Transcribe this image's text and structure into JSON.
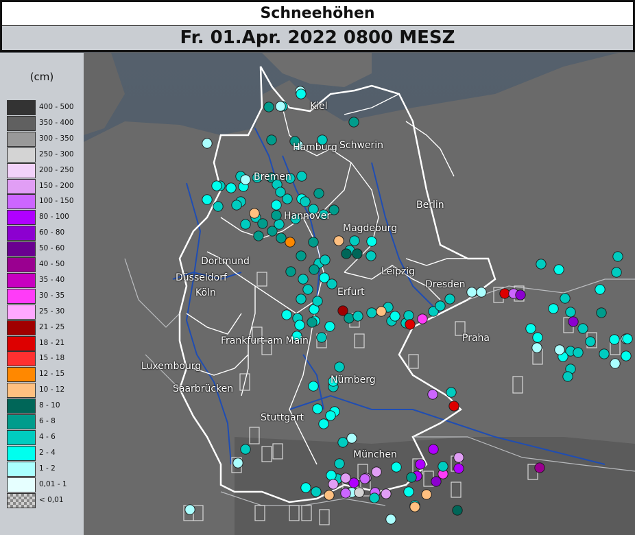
{
  "header": {
    "title": "Schneehöhen",
    "subtitle": "Fr. 01.Apr. 2022 0800 MESZ"
  },
  "legend": {
    "unit": "(cm)",
    "classes": [
      {
        "label": "400 - 500",
        "color": "#333333"
      },
      {
        "label": "350 - 400",
        "color": "#606060"
      },
      {
        "label": "300 - 350",
        "color": "#999999"
      },
      {
        "label": "250 - 300",
        "color": "#d4d4d4"
      },
      {
        "label": "200 - 250",
        "color": "#f2d2fa"
      },
      {
        "label": "150 - 200",
        "color": "#e19ef5"
      },
      {
        "label": "100 - 150",
        "color": "#cc66ff"
      },
      {
        "label": "80 - 100",
        "color": "#b000ff"
      },
      {
        "label": "60 - 80",
        "color": "#8c00d0"
      },
      {
        "label": "50 - 60",
        "color": "#6a0090"
      },
      {
        "label": "40 - 50",
        "color": "#9a0090"
      },
      {
        "label": "35 - 40",
        "color": "#c800c0"
      },
      {
        "label": "30 - 35",
        "color": "#ff3cf8"
      },
      {
        "label": "25 - 30",
        "color": "#ffa8ff"
      },
      {
        "label": "21 - 25",
        "color": "#a00000"
      },
      {
        "label": "18 - 21",
        "color": "#dd0000"
      },
      {
        "label": "15 - 18",
        "color": "#ff3030"
      },
      {
        "label": "12 - 15",
        "color": "#ff8800"
      },
      {
        "label": "10 - 12",
        "color": "#ffc080"
      },
      {
        "label": "8 - 10",
        "color": "#006658"
      },
      {
        "label": "6 - 8",
        "color": "#009c8c"
      },
      {
        "label": "4 - 6",
        "color": "#00ccc0"
      },
      {
        "label": "2 - 4",
        "color": "#00ffee"
      },
      {
        "label": "1 - 2",
        "color": "#aaffff"
      },
      {
        "label": "0,01 - 1",
        "color": "#e6ffff"
      },
      {
        "label": "< 0,01",
        "color": "checker"
      }
    ]
  },
  "cities": [
    {
      "name": "Kiel"
    },
    {
      "name": "Hamburg"
    },
    {
      "name": "Schwerin"
    },
    {
      "name": "Bremen"
    },
    {
      "name": "Berlin"
    },
    {
      "name": "Hannover"
    },
    {
      "name": "Magdeburg"
    },
    {
      "name": "Dortmund"
    },
    {
      "name": "Düsseldorf"
    },
    {
      "name": "Leipzig"
    },
    {
      "name": "Köln"
    },
    {
      "name": "Dresden"
    },
    {
      "name": "Erfurt"
    },
    {
      "name": "Frankfurt am Main"
    },
    {
      "name": "Praha"
    },
    {
      "name": "Luxembourg"
    },
    {
      "name": "Nürnberg"
    },
    {
      "name": "Saarbrücken"
    },
    {
      "name": "Stuttgart"
    },
    {
      "name": "München"
    }
  ],
  "stations": [
    {
      "c": "#aaffff"
    },
    {
      "c": "#00ccc0"
    },
    {
      "c": "#009c8c"
    },
    {
      "c": "#aaffff"
    },
    {
      "c": "#00ccc0"
    },
    {
      "c": "#009c8c"
    },
    {
      "c": "#00ffee"
    },
    {
      "c": "#aaffff"
    },
    {
      "c": "#009c8c"
    },
    {
      "c": "#009c8c"
    },
    {
      "c": "#aaffff"
    },
    {
      "c": "#00ffee"
    },
    {
      "c": "#00ccc0"
    },
    {
      "c": "#aaffff"
    },
    {
      "c": "#00ccc0"
    },
    {
      "c": "#00ffee"
    },
    {
      "c": "#00ccc0"
    },
    {
      "c": "#009c8c"
    },
    {
      "c": "#00ccc0"
    },
    {
      "c": "#00ccc0"
    },
    {
      "c": "#00ccc0"
    },
    {
      "c": "#00ffee"
    },
    {
      "c": "#00ccc0"
    },
    {
      "c": "#00ccc0"
    },
    {
      "c": "#009c8c"
    },
    {
      "c": "#00ffee"
    },
    {
      "c": "#00ccc0"
    },
    {
      "c": "#00ccc0"
    },
    {
      "c": "#00ccc0"
    },
    {
      "c": "#00ffee"
    },
    {
      "c": "#00ffee"
    },
    {
      "c": "#00ccc0"
    },
    {
      "c": "#ffc080"
    },
    {
      "c": "#009c8c"
    },
    {
      "c": "#00ccc0"
    },
    {
      "c": "#009c8c"
    },
    {
      "c": "#00ccc0"
    },
    {
      "c": "#009c8c"
    },
    {
      "c": "#00ccc0"
    },
    {
      "c": "#00ccc0"
    },
    {
      "c": "#00ccc0"
    },
    {
      "c": "#00ccc0"
    },
    {
      "c": "#009c8c"
    },
    {
      "c": "#009c8c"
    },
    {
      "c": "#009c8c"
    },
    {
      "c": "#ff8800"
    },
    {
      "c": "#009c8c"
    },
    {
      "c": "#ffc080"
    },
    {
      "c": "#00ccc0"
    },
    {
      "c": "#00ccc0"
    },
    {
      "c": "#00ffee"
    },
    {
      "c": "#00ccc0"
    },
    {
      "c": "#009c8c"
    },
    {
      "c": "#009c8c"
    },
    {
      "c": "#009c8c"
    },
    {
      "c": "#00ccc0"
    },
    {
      "c": "#006658"
    },
    {
      "c": "#006658"
    },
    {
      "c": "#00ccc0"
    },
    {
      "c": "#00ccc0"
    },
    {
      "c": "#00ccc0"
    },
    {
      "c": "#00ffee"
    },
    {
      "c": "#00ccc0"
    },
    {
      "c": "#00ccc0"
    },
    {
      "c": "#00ffee"
    },
    {
      "c": "#00ccc0"
    },
    {
      "c": "#00ffee"
    },
    {
      "c": "#00ffee"
    },
    {
      "c": "#a00000"
    },
    {
      "c": "#009c8c"
    },
    {
      "c": "#00ccc0"
    },
    {
      "c": "#00ccc0"
    },
    {
      "c": "#00ccc0"
    },
    {
      "c": "#00ccc0"
    },
    {
      "c": "#ffc080"
    },
    {
      "c": "#00ffee"
    },
    {
      "c": "#00ccc0"
    },
    {
      "c": "#00ccc0"
    },
    {
      "c": "#dd0000"
    },
    {
      "c": "#ff3cf8"
    },
    {
      "c": "#00ccc0"
    },
    {
      "c": "#00ccc0"
    },
    {
      "c": "#00ccc0"
    },
    {
      "c": "#aaffff"
    },
    {
      "c": "#aaffff"
    },
    {
      "c": "#dd0000"
    },
    {
      "c": "#cc66ff"
    },
    {
      "c": "#8c00d0"
    },
    {
      "c": "#00ffee"
    },
    {
      "c": "#00ccc0"
    },
    {
      "c": "#00ccc0"
    },
    {
      "c": "#00ccc0"
    },
    {
      "c": "#00ccc0"
    },
    {
      "c": "#00ccc0"
    },
    {
      "c": "#00ffee"
    },
    {
      "c": "#00ffee"
    },
    {
      "c": "#00ffee"
    },
    {
      "c": "#00ccc0"
    },
    {
      "c": "#00ffee"
    },
    {
      "c": "#00ccc0"
    },
    {
      "c": "#00ccc0"
    },
    {
      "c": "#00ffee"
    },
    {
      "c": "#009c8c"
    },
    {
      "c": "#00ffee"
    },
    {
      "c": "#00ffee"
    },
    {
      "c": "#00ccc0"
    },
    {
      "c": "#00ccc0"
    },
    {
      "c": "#00ccc0"
    },
    {
      "c": "#00ffee"
    },
    {
      "c": "#00ffee"
    },
    {
      "c": "#00ffee"
    },
    {
      "c": "#00ffee"
    },
    {
      "c": "#cc66ff"
    },
    {
      "c": "#00ccc0"
    },
    {
      "c": "#dd0000"
    },
    {
      "c": "#aaffff"
    },
    {
      "c": "#aaffff"
    },
    {
      "c": "#aaffff"
    },
    {
      "c": "#00ffee"
    },
    {
      "c": "#00ccc0"
    },
    {
      "c": "#00ccc0"
    },
    {
      "c": "#00ccc0"
    },
    {
      "c": "#00ccc0"
    },
    {
      "c": "#aaffff"
    },
    {
      "c": "#00ccc0"
    },
    {
      "c": "#8c00d0"
    },
    {
      "c": "#009c8c"
    },
    {
      "c": "#00ffee"
    },
    {
      "c": "#00ffee"
    },
    {
      "c": "#00ffee"
    },
    {
      "c": "#b000ff"
    },
    {
      "c": "#9a0090"
    },
    {
      "c": "#aaffff"
    },
    {
      "c": "#ff3cf8"
    },
    {
      "c": "#aaffff"
    },
    {
      "c": "#00ccc0"
    },
    {
      "c": "#00ffee"
    },
    {
      "c": "#00ffee"
    },
    {
      "c": "#00ffee"
    },
    {
      "c": "#aaffff"
    },
    {
      "c": "#aaffff"
    },
    {
      "c": "#00ccc0"
    },
    {
      "c": "#00ccc0"
    },
    {
      "c": "#ffc080"
    },
    {
      "c": "#cc66ff"
    },
    {
      "c": "#d4d4d4"
    },
    {
      "c": "#b000ff"
    },
    {
      "c": "#e19ef5"
    },
    {
      "c": "#cc66ff"
    },
    {
      "c": "#b000ff"
    },
    {
      "c": "#b000ff"
    },
    {
      "c": "#e19ef5"
    },
    {
      "c": "#ffc080"
    },
    {
      "c": "#b000ff"
    },
    {
      "c": "#8c00d0"
    },
    {
      "c": "#009c8c"
    },
    {
      "c": "#ffc080"
    },
    {
      "c": "#cc66ff"
    },
    {
      "c": "#e19ef5"
    },
    {
      "c": "#00ccc0"
    },
    {
      "c": "#00ffee"
    },
    {
      "c": "#00ccc0"
    },
    {
      "c": "#e19ef5"
    },
    {
      "c": "#00ffee"
    },
    {
      "c": "#00ffee"
    },
    {
      "c": "#e19ef5"
    },
    {
      "c": "#e19ef5"
    },
    {
      "c": "#006658"
    },
    {
      "c": "#00ccc0"
    },
    {
      "c": "#00ffee"
    },
    {
      "c": "#00ccc0"
    },
    {
      "c": "#aaffff"
    }
  ]
}
